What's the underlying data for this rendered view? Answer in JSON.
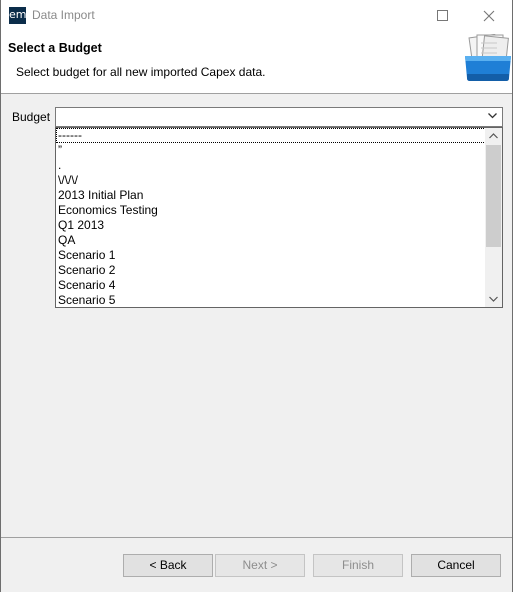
{
  "window": {
    "app_icon_text": "em",
    "title": "Data Import"
  },
  "header": {
    "title": "Select a Budget",
    "description": "Select budget for all new imported Capex data.",
    "image_icon": "folder-with-documents-icon"
  },
  "form": {
    "budget_label": "Budget",
    "budget_value": "",
    "options": [
      "------",
      "”",
      ".",
      "\\/\\/\\/",
      "2013 Initial Plan",
      "Economics Testing",
      "Q1 2013",
      "QA",
      "Scenario 1",
      "Scenario 2",
      "Scenario 4",
      "Scenario 5"
    ]
  },
  "buttons": {
    "back": "< Back",
    "next": "Next >",
    "finish": "Finish",
    "cancel": "Cancel"
  },
  "colors": {
    "app_icon_bg": "#0b2d4a",
    "folder_blue": "#1f7fd6",
    "disabled_text": "#8d8d8d"
  }
}
